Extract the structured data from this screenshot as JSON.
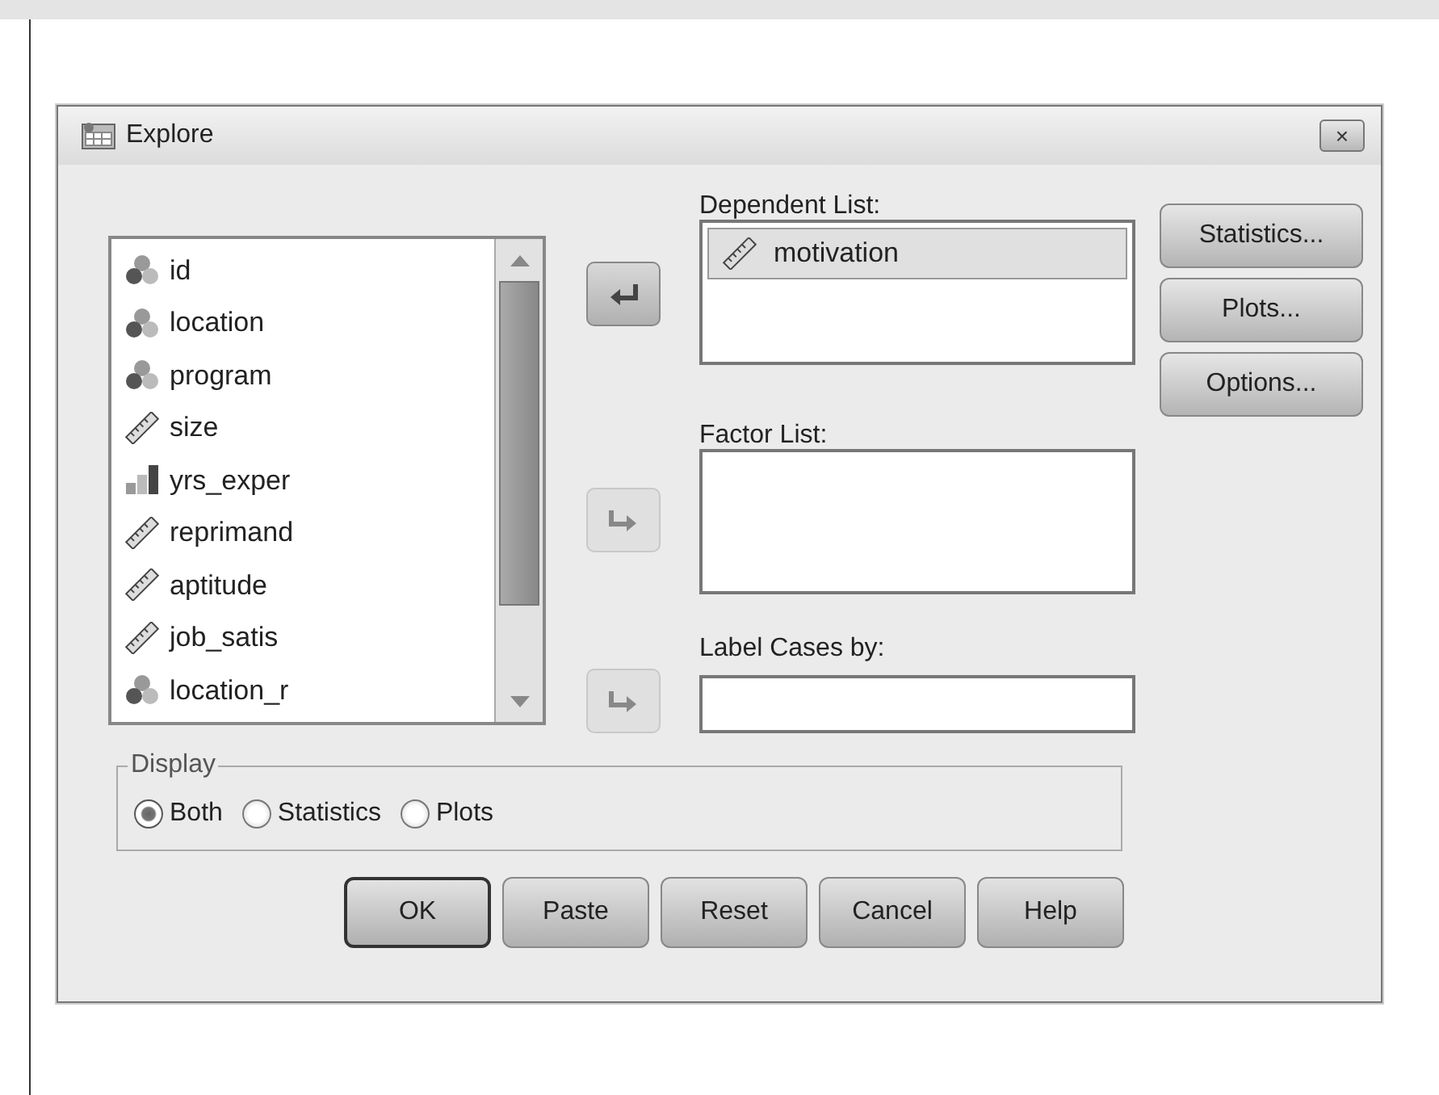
{
  "window": {
    "title": "Explore",
    "close": "×"
  },
  "variables": [
    {
      "name": "id",
      "kind": "nominal"
    },
    {
      "name": "location",
      "kind": "nominal"
    },
    {
      "name": "program",
      "kind": "nominal"
    },
    {
      "name": "size",
      "kind": "scale"
    },
    {
      "name": "yrs_exper",
      "kind": "ordinal"
    },
    {
      "name": "reprimand",
      "kind": "scale"
    },
    {
      "name": "aptitude",
      "kind": "scale"
    },
    {
      "name": "job_satis",
      "kind": "scale"
    },
    {
      "name": "location_r",
      "kind": "nominal"
    }
  ],
  "move_buttons": [
    {
      "kind": "back",
      "disabled": false
    },
    {
      "kind": "forward",
      "disabled": true
    },
    {
      "kind": "forward",
      "disabled": true
    }
  ],
  "dependent_list": {
    "label": "Dependent List:",
    "items": [
      {
        "name": "motivation",
        "kind": "scale",
        "selected": true
      }
    ]
  },
  "factor_list": {
    "label": "Factor List:"
  },
  "label_cases": {
    "label": "Label Cases by:"
  },
  "side_buttons": [
    {
      "label": "Statistics..."
    },
    {
      "label": "Plots..."
    },
    {
      "label": "Options..."
    }
  ],
  "display": {
    "legend": "Display",
    "options": [
      {
        "label": "Both",
        "selected": true
      },
      {
        "label": "Statistics",
        "selected": false
      },
      {
        "label": "Plots",
        "selected": false
      }
    ]
  },
  "buttons": [
    {
      "label": "OK",
      "default": true
    },
    {
      "label": "Paste",
      "default": false
    },
    {
      "label": "Reset",
      "default": false
    },
    {
      "label": "Cancel",
      "default": false
    },
    {
      "label": "Help",
      "default": false
    }
  ]
}
